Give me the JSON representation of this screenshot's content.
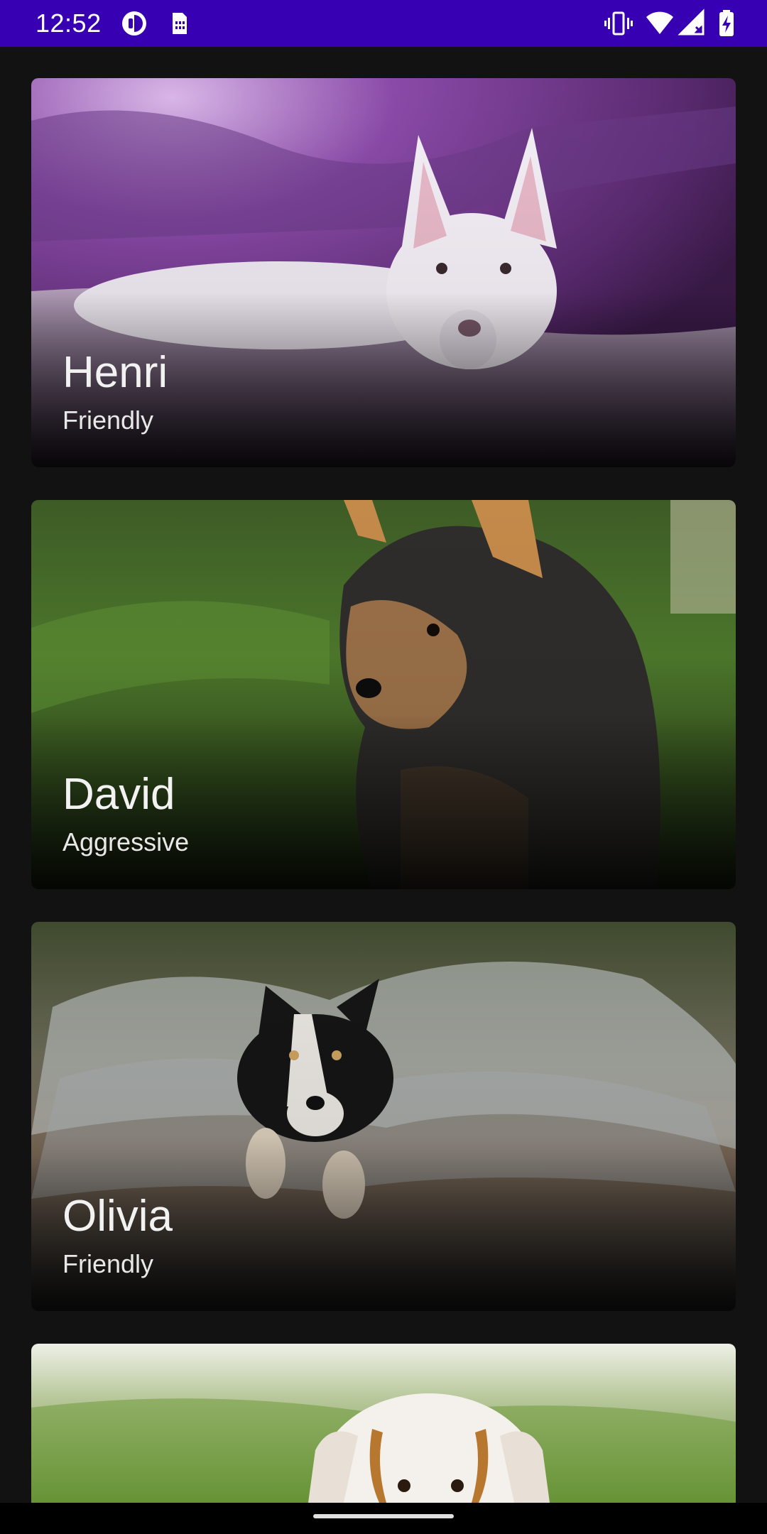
{
  "status_bar": {
    "time": "12:52",
    "left_icons": [
      "pocket-icon",
      "sim-card-icon"
    ],
    "right_icons": [
      "vibrate-icon",
      "wifi-icon",
      "signal-no-data-icon",
      "battery-charging-icon"
    ],
    "background": "#3700b3"
  },
  "dogs": [
    {
      "name": "Henri",
      "temperament": "Friendly"
    },
    {
      "name": "David",
      "temperament": "Aggressive"
    },
    {
      "name": "Olivia",
      "temperament": "Friendly"
    },
    {
      "name": "",
      "temperament": ""
    }
  ],
  "colors": {
    "background": "#121212",
    "card_text": "#f2f2f2"
  }
}
